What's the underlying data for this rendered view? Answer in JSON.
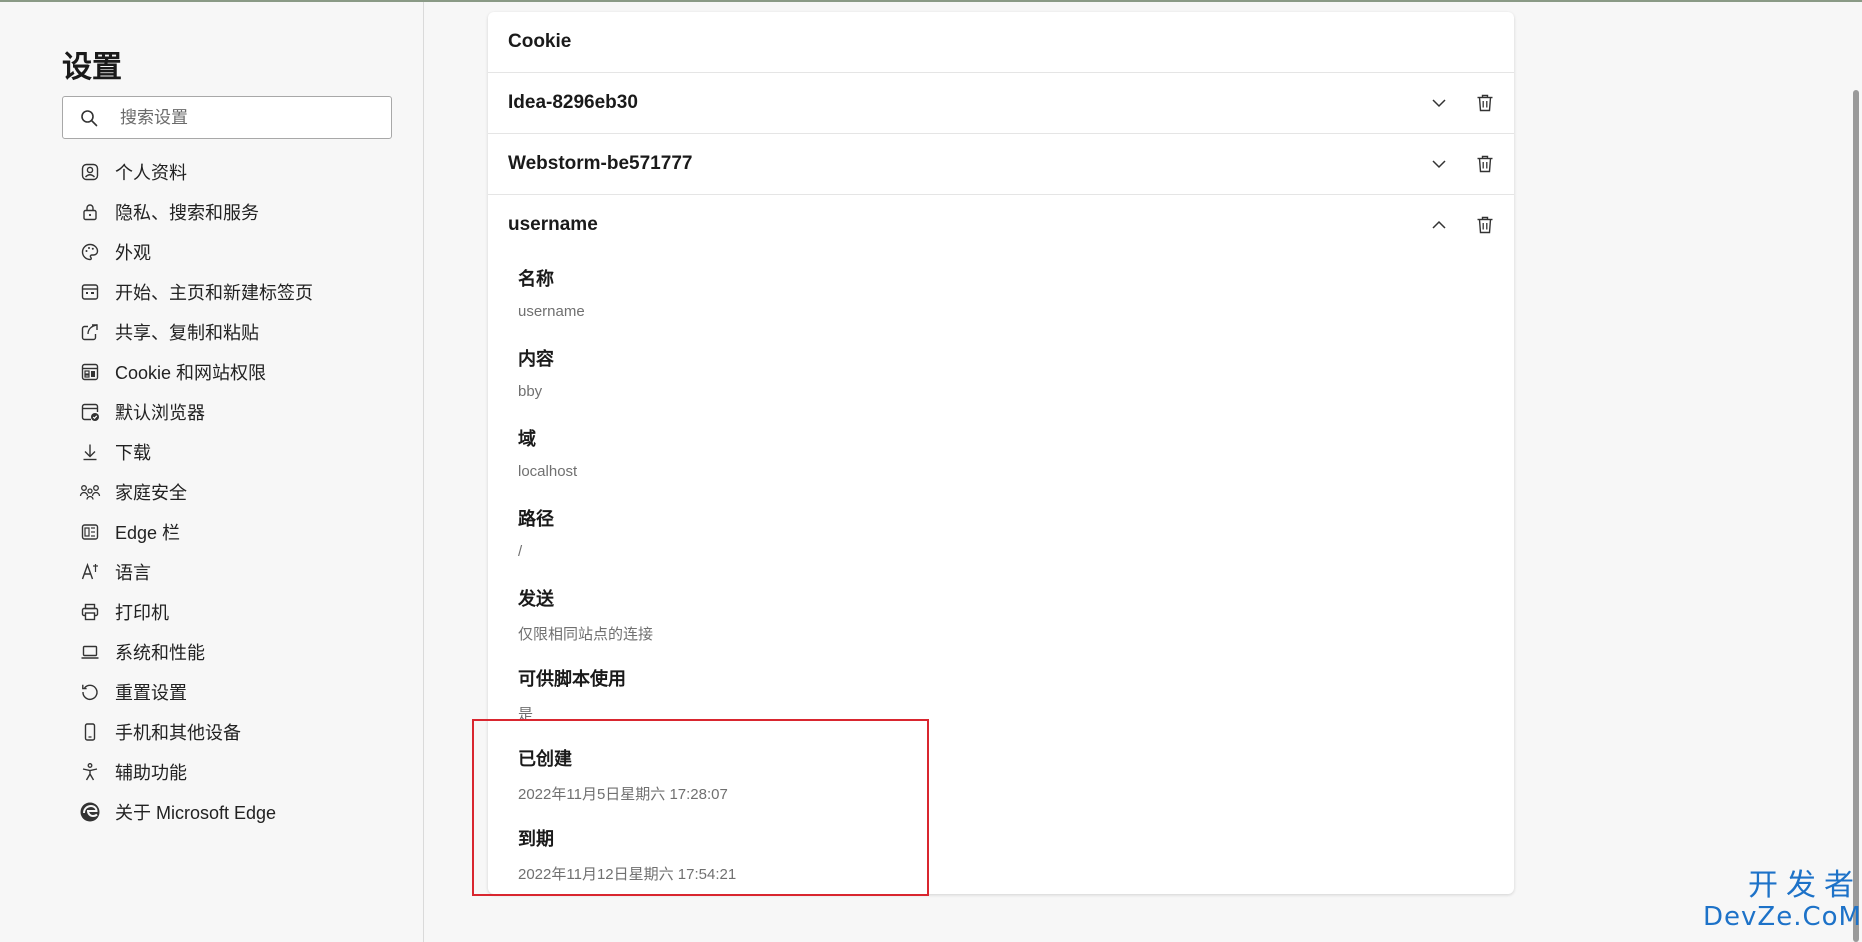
{
  "sidebar": {
    "title": "设置",
    "search_placeholder": "搜索设置",
    "items": [
      {
        "label": "个人资料",
        "icon": "profile-icon"
      },
      {
        "label": "隐私、搜索和服务",
        "icon": "lock-icon"
      },
      {
        "label": "外观",
        "icon": "palette-icon"
      },
      {
        "label": "开始、主页和新建标签页",
        "icon": "home-page-icon"
      },
      {
        "label": "共享、复制和粘贴",
        "icon": "share-icon"
      },
      {
        "label": "Cookie 和网站权限",
        "icon": "site-permissions-icon"
      },
      {
        "label": "默认浏览器",
        "icon": "default-browser-icon"
      },
      {
        "label": "下载",
        "icon": "download-icon"
      },
      {
        "label": "家庭安全",
        "icon": "family-icon"
      },
      {
        "label": "Edge 栏",
        "icon": "edge-bar-icon"
      },
      {
        "label": "语言",
        "icon": "language-icon"
      },
      {
        "label": "打印机",
        "icon": "printer-icon"
      },
      {
        "label": "系统和性能",
        "icon": "laptop-icon"
      },
      {
        "label": "重置设置",
        "icon": "reset-icon"
      },
      {
        "label": "手机和其他设备",
        "icon": "phone-icon"
      },
      {
        "label": "辅助功能",
        "icon": "accessibility-icon"
      },
      {
        "label": "关于 Microsoft Edge",
        "icon": "edge-logo-icon"
      }
    ]
  },
  "main": {
    "header": "Cookie",
    "cookies": [
      {
        "name": "Idea-8296eb30",
        "expanded": false
      },
      {
        "name": "Webstorm-be571777",
        "expanded": false
      },
      {
        "name": "username",
        "expanded": true
      }
    ],
    "details": [
      {
        "label": "名称",
        "value": "username"
      },
      {
        "label": "内容",
        "value": "bby"
      },
      {
        "label": "域",
        "value": "localhost"
      },
      {
        "label": "路径",
        "value": "/"
      },
      {
        "label": "发送",
        "value": "仅限相同站点的连接"
      },
      {
        "label": "可供脚本使用",
        "value": "是"
      },
      {
        "label": "已创建",
        "value": "2022年11月5日星期六 17:28:07"
      },
      {
        "label": "到期",
        "value": "2022年11月12日星期六 17:54:21"
      }
    ]
  },
  "annotation": {
    "color": "#d9262f"
  },
  "watermark": {
    "cn": "开发者",
    "en": "DevZe.CoM"
  }
}
